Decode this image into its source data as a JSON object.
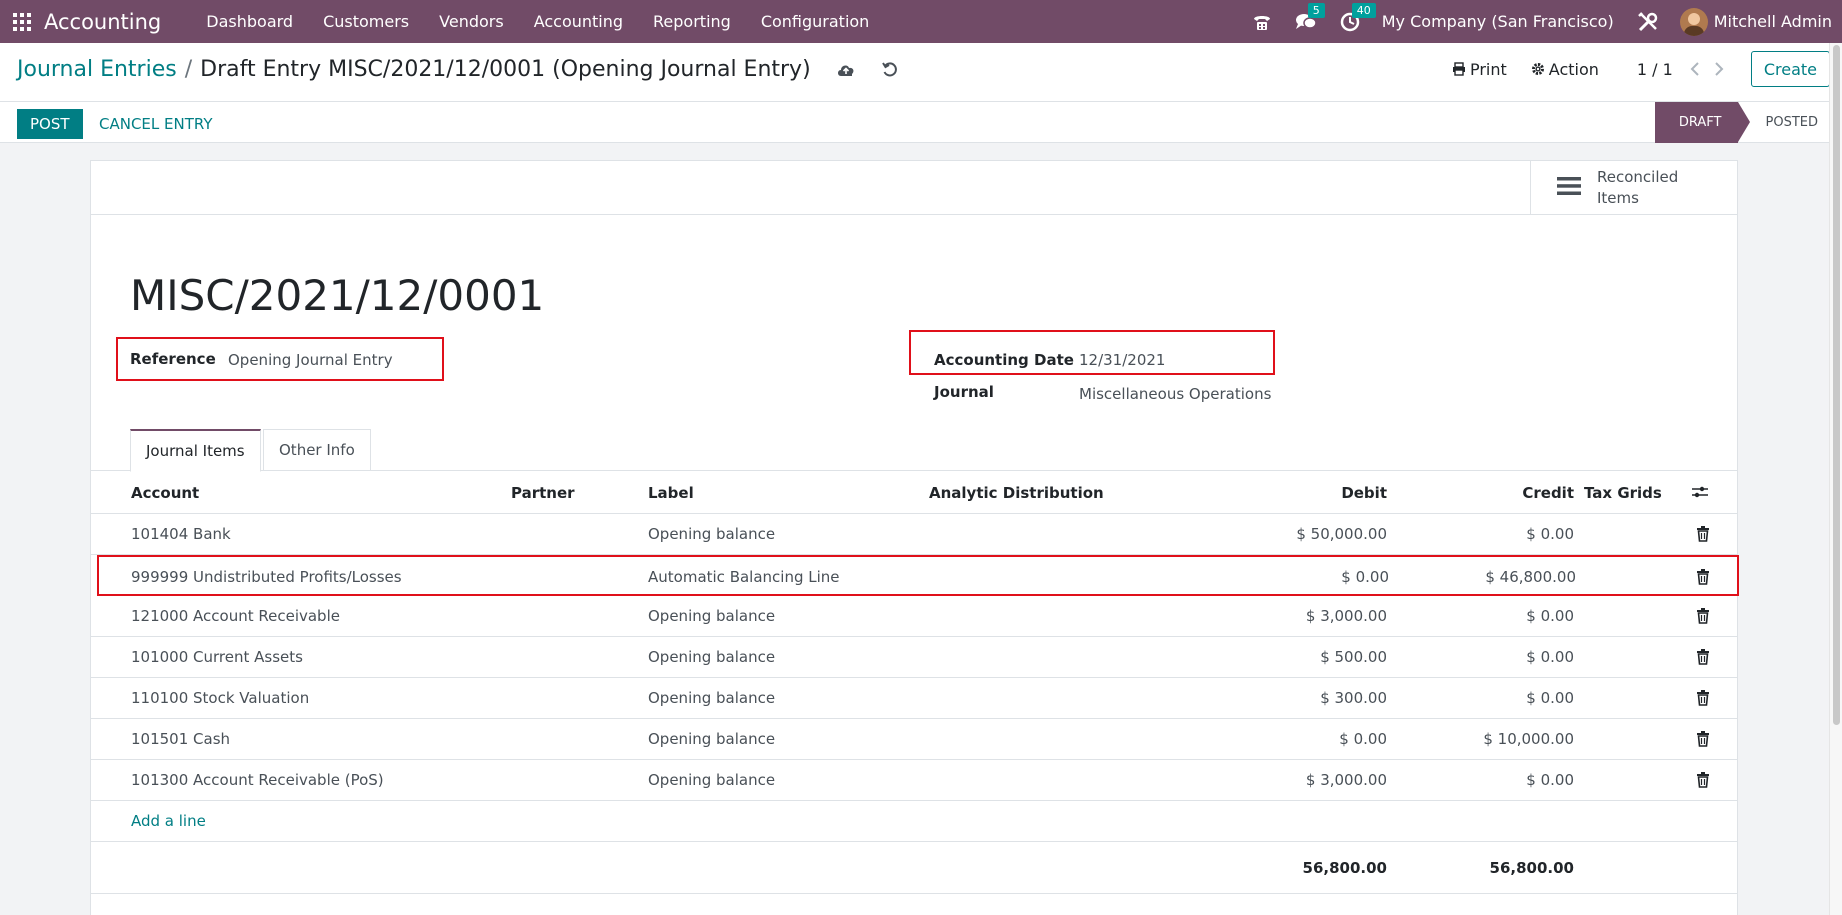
{
  "navbar": {
    "brand": "Accounting",
    "menu": [
      "Dashboard",
      "Customers",
      "Vendors",
      "Accounting",
      "Reporting",
      "Configuration"
    ],
    "messages_count": "5",
    "activities_count": "40",
    "company": "My Company (San Francisco)",
    "user": "Mitchell Admin"
  },
  "breadcrumb": {
    "parent": "Journal Entries",
    "separator": "/",
    "current": "Draft Entry MISC/2021/12/0001 (Opening Journal Entry)"
  },
  "control": {
    "print_label": "Print",
    "action_label": "Action",
    "pager": "1 / 1",
    "create_label": "Create"
  },
  "status_actions": {
    "post_label": "POST",
    "cancel_label": "CANCEL ENTRY",
    "stages": [
      "DRAFT",
      "POSTED"
    ],
    "current_stage": "DRAFT"
  },
  "smart_button": {
    "label": "Reconciled Items"
  },
  "record": {
    "name": "MISC/2021/12/0001",
    "reference_label": "Reference",
    "reference_value": "Opening Journal Entry",
    "date_label": "Accounting Date",
    "date_value": "12/31/2021",
    "journal_label": "Journal",
    "journal_value": "Miscellaneous Operations"
  },
  "tabs": [
    "Journal Items",
    "Other Info"
  ],
  "table": {
    "columns": [
      "Account",
      "Partner",
      "Label",
      "Analytic Distribution",
      "Debit",
      "Credit",
      "Tax Grids"
    ],
    "rows": [
      {
        "account": "101404 Bank",
        "partner": "",
        "label": "Opening balance",
        "analytic": "",
        "debit": "$ 50,000.00",
        "credit": "$ 0.00"
      },
      {
        "account": "999999 Undistributed Profits/Losses",
        "partner": "",
        "label": "Automatic Balancing Line",
        "analytic": "",
        "debit": "$ 0.00",
        "credit": "$ 46,800.00"
      },
      {
        "account": "121000 Account Receivable",
        "partner": "",
        "label": "Opening balance",
        "analytic": "",
        "debit": "$ 3,000.00",
        "credit": "$ 0.00"
      },
      {
        "account": "101000 Current Assets",
        "partner": "",
        "label": "Opening balance",
        "analytic": "",
        "debit": "$ 500.00",
        "credit": "$ 0.00"
      },
      {
        "account": "110100 Stock Valuation",
        "partner": "",
        "label": "Opening balance",
        "analytic": "",
        "debit": "$ 300.00",
        "credit": "$ 0.00"
      },
      {
        "account": "101501 Cash",
        "partner": "",
        "label": "Opening balance",
        "analytic": "",
        "debit": "$ 0.00",
        "credit": "$ 10,000.00"
      },
      {
        "account": "101300 Account Receivable (PoS)",
        "partner": "",
        "label": "Opening balance",
        "analytic": "",
        "debit": "$ 3,000.00",
        "credit": "$ 0.00"
      }
    ],
    "add_line": "Add a line",
    "total_debit": "56,800.00",
    "total_credit": "56,800.00"
  },
  "colors": {
    "brand": "#714b67",
    "accent": "#017e84",
    "highlight_border": "#e0101a"
  }
}
